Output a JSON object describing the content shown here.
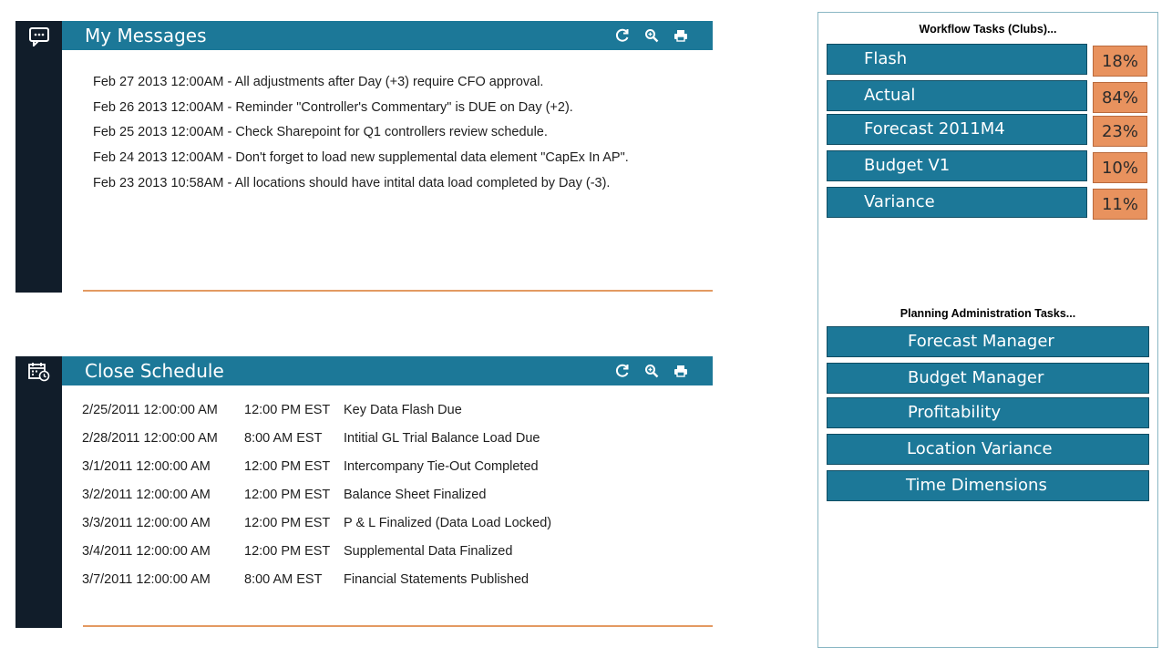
{
  "messages": {
    "title": "My Messages",
    "icons": [
      "chat-icon",
      "refresh-icon",
      "zoom-icon",
      "print-icon"
    ],
    "items": [
      "Feb 27 2013 12:00AM - All adjustments after Day (+3) require CFO approval.",
      "Feb 26 2013 12:00AM - Reminder \"Controller's Commentary\" is DUE on Day (+2).",
      "Feb 25 2013 12:00AM - Check Sharepoint for Q1 controllers review schedule.",
      "Feb 24 2013 12:00AM - Don't forget to load new supplemental data element \"CapEx In AP\".",
      "Feb 23 2013 10:58AM - All locations should have intital data load completed by Day (-3)."
    ]
  },
  "schedule": {
    "title": "Close Schedule",
    "icons": [
      "calendar-clock-icon",
      "refresh-icon",
      "zoom-icon",
      "print-icon"
    ],
    "rows": [
      {
        "date": "2/25/2011 12:00:00 AM",
        "time": "12:00 PM EST",
        "task": "Key Data Flash Due"
      },
      {
        "date": "2/28/2011 12:00:00 AM",
        "time": "8:00 AM EST",
        "task": "Intitial GL Trial Balance Load Due"
      },
      {
        "date": "3/1/2011 12:00:00 AM",
        "time": "12:00 PM EST",
        "task": "Intercompany Tie-Out Completed"
      },
      {
        "date": "3/2/2011 12:00:00 AM",
        "time": "12:00 PM EST",
        "task": "Balance Sheet Finalized"
      },
      {
        "date": "3/3/2011 12:00:00 AM",
        "time": "12:00 PM EST",
        "task": "P & L Finalized (Data Load Locked)"
      },
      {
        "date": "3/4/2011 12:00:00 AM",
        "time": "12:00 PM EST",
        "task": "Supplemental Data Finalized"
      },
      {
        "date": "3/7/2011 12:00:00 AM",
        "time": "8:00 AM EST",
        "task": "Financial Statements Published"
      }
    ]
  },
  "workflow": {
    "title": "Workflow Tasks (Clubs)...",
    "items": [
      {
        "label": "Flash",
        "pct": "18%"
      },
      {
        "label": "Actual",
        "pct": "84%"
      },
      {
        "label": "Forecast 2011M4",
        "pct": "23%"
      },
      {
        "label": "Budget V1",
        "pct": "10%"
      },
      {
        "label": "Variance",
        "pct": "11%"
      }
    ]
  },
  "admin": {
    "title": "Planning Administration Tasks...",
    "items": [
      "Forecast Manager",
      "Budget Manager",
      "Profitability",
      "Location Variance",
      "Time Dimensions"
    ]
  },
  "colors": {
    "header": "#1c7898",
    "rail": "#111d2a",
    "accent_rule": "#e39a62",
    "percent_badge": "#e8925e",
    "side_border": "#8ab7c4"
  }
}
